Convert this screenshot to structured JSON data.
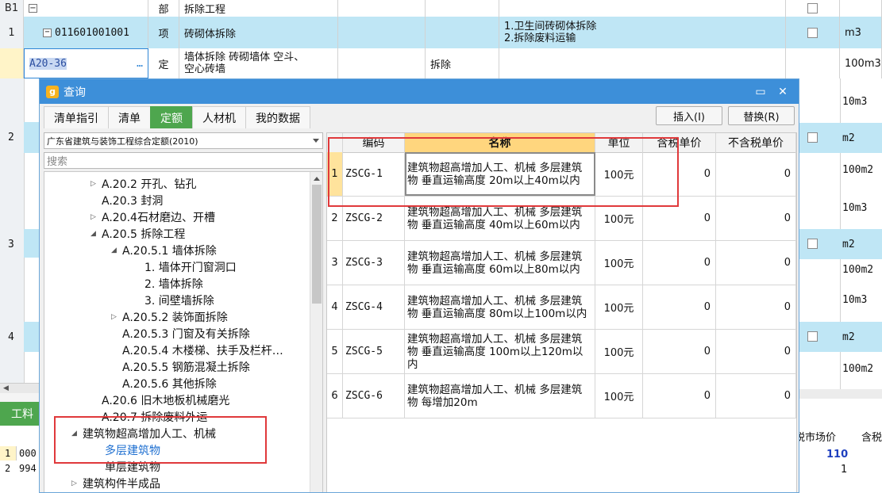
{
  "grid": {
    "row_b1": {
      "num": "B1",
      "type": "部",
      "name": "拆除工程"
    },
    "row_1": {
      "num": "1",
      "code": "011601001001",
      "type": "项",
      "name": "砖砌体拆除",
      "desc1": "1.卫生间砖砌体拆除",
      "desc2": "2.拆除废料运输",
      "unit": "m3"
    },
    "row_quota": {
      "code": "A20-36",
      "more": "…",
      "type": "定",
      "name1": "墙体拆除 砖砌墙体 空斗、",
      "name2": "空心砖墙",
      "spec": "拆除",
      "unit": "100m3"
    },
    "right_units": [
      "10m3",
      "m2",
      "100m2",
      "10m3",
      "m2",
      "100m2",
      "10m3",
      "m2",
      "100m2"
    ],
    "left_nums": [
      "2",
      "3",
      "4"
    ],
    "bottom": {
      "tab": "工料",
      "r1_num": "1",
      "r1_code": "000",
      "r2_num": "2",
      "r2_code": "994",
      "col1": "税市场价",
      "col2": "含税",
      "v1": "110",
      "v2": "1"
    }
  },
  "dialog": {
    "title": "查询",
    "tabs": [
      "清单指引",
      "清单",
      "定额",
      "人材机",
      "我的数据"
    ],
    "active_tab": "定额",
    "insert_btn": "插入(I)",
    "replace_btn": "替换(R)",
    "combo_value": "广东省建筑与装饰工程综合定额(2010)",
    "search_placeholder": "搜索",
    "tree": [
      "A.20.2 开孔、钻孔",
      "A.20.3 封洞",
      "A.20.4石材磨边、开槽",
      "A.20.5 拆除工程",
      "A.20.5.1 墙体拆除",
      "1. 墙体开门窗洞口",
      "2. 墙体拆除",
      "3. 间壁墙拆除",
      "A.20.5.2 装饰面拆除",
      "A.20.5.3 门窗及有关拆除",
      "A.20.5.4 木楼梯、扶手及栏杆…",
      "A.20.5.5 钢筋混凝土拆除",
      "A.20.5.6 其他拆除",
      "A.20.6 旧木地板机械磨光",
      "A.20.7 拆除废料外运",
      "建筑物超高增加人工、机械",
      "多层建筑物",
      "单层建筑物",
      "建筑构件半成品"
    ],
    "table": {
      "headers": [
        "编码",
        "名称",
        "单位",
        "含税单价",
        "不含税单价"
      ],
      "rows": [
        {
          "idx": "1",
          "code": "ZSCG-1",
          "name": "建筑物超高增加人工、机械 多层建筑物 垂直运输高度 20m以上40m以内",
          "unit": "100元",
          "tax": "0",
          "notax": "0"
        },
        {
          "idx": "2",
          "code": "ZSCG-2",
          "name": "建筑物超高增加人工、机械 多层建筑物 垂直运输高度 40m以上60m以内",
          "unit": "100元",
          "tax": "0",
          "notax": "0"
        },
        {
          "idx": "3",
          "code": "ZSCG-3",
          "name": "建筑物超高增加人工、机械 多层建筑物 垂直运输高度 60m以上80m以内",
          "unit": "100元",
          "tax": "0",
          "notax": "0"
        },
        {
          "idx": "4",
          "code": "ZSCG-4",
          "name": "建筑物超高增加人工、机械 多层建筑物 垂直运输高度 80m以上100m以内",
          "unit": "100元",
          "tax": "0",
          "notax": "0"
        },
        {
          "idx": "5",
          "code": "ZSCG-5",
          "name": "建筑物超高增加人工、机械 多层建筑物 垂直运输高度 100m以上120m以内",
          "unit": "100元",
          "tax": "0",
          "notax": "0"
        },
        {
          "idx": "6",
          "code": "ZSCG-6",
          "name": "建筑物超高增加人工、机械 多层建筑物 每增加20m",
          "unit": "100元",
          "tax": "0",
          "notax": "0"
        }
      ]
    }
  },
  "colors": {
    "accent_blue": "#3d8fd9",
    "tab_green": "#4ea64e",
    "header_highlight": "#ffd67e",
    "annotation_red": "#e0393b",
    "link_blue": "#1e6fd0"
  }
}
